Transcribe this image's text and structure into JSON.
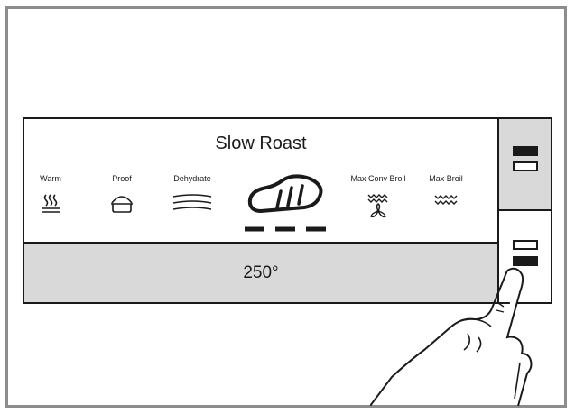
{
  "oven": {
    "selected_mode": "Slow Roast",
    "temperature": "250°",
    "modes": [
      {
        "label": "Warm",
        "icon": "warm-steam-icon"
      },
      {
        "label": "Proof",
        "icon": "proof-dough-icon"
      },
      {
        "label": "Dehydrate",
        "icon": "dehydrate-icon"
      },
      {
        "label": "Max Conv Broil",
        "icon": "conv-broil-fan-icon"
      },
      {
        "label": "Max Broil",
        "icon": "broil-icon"
      }
    ],
    "selected_icon": "slow-roast-meat-icon"
  },
  "colors": {
    "frame": "#8c8c8c",
    "line": "#1a1a1a",
    "shade": "#d9d9d9"
  }
}
